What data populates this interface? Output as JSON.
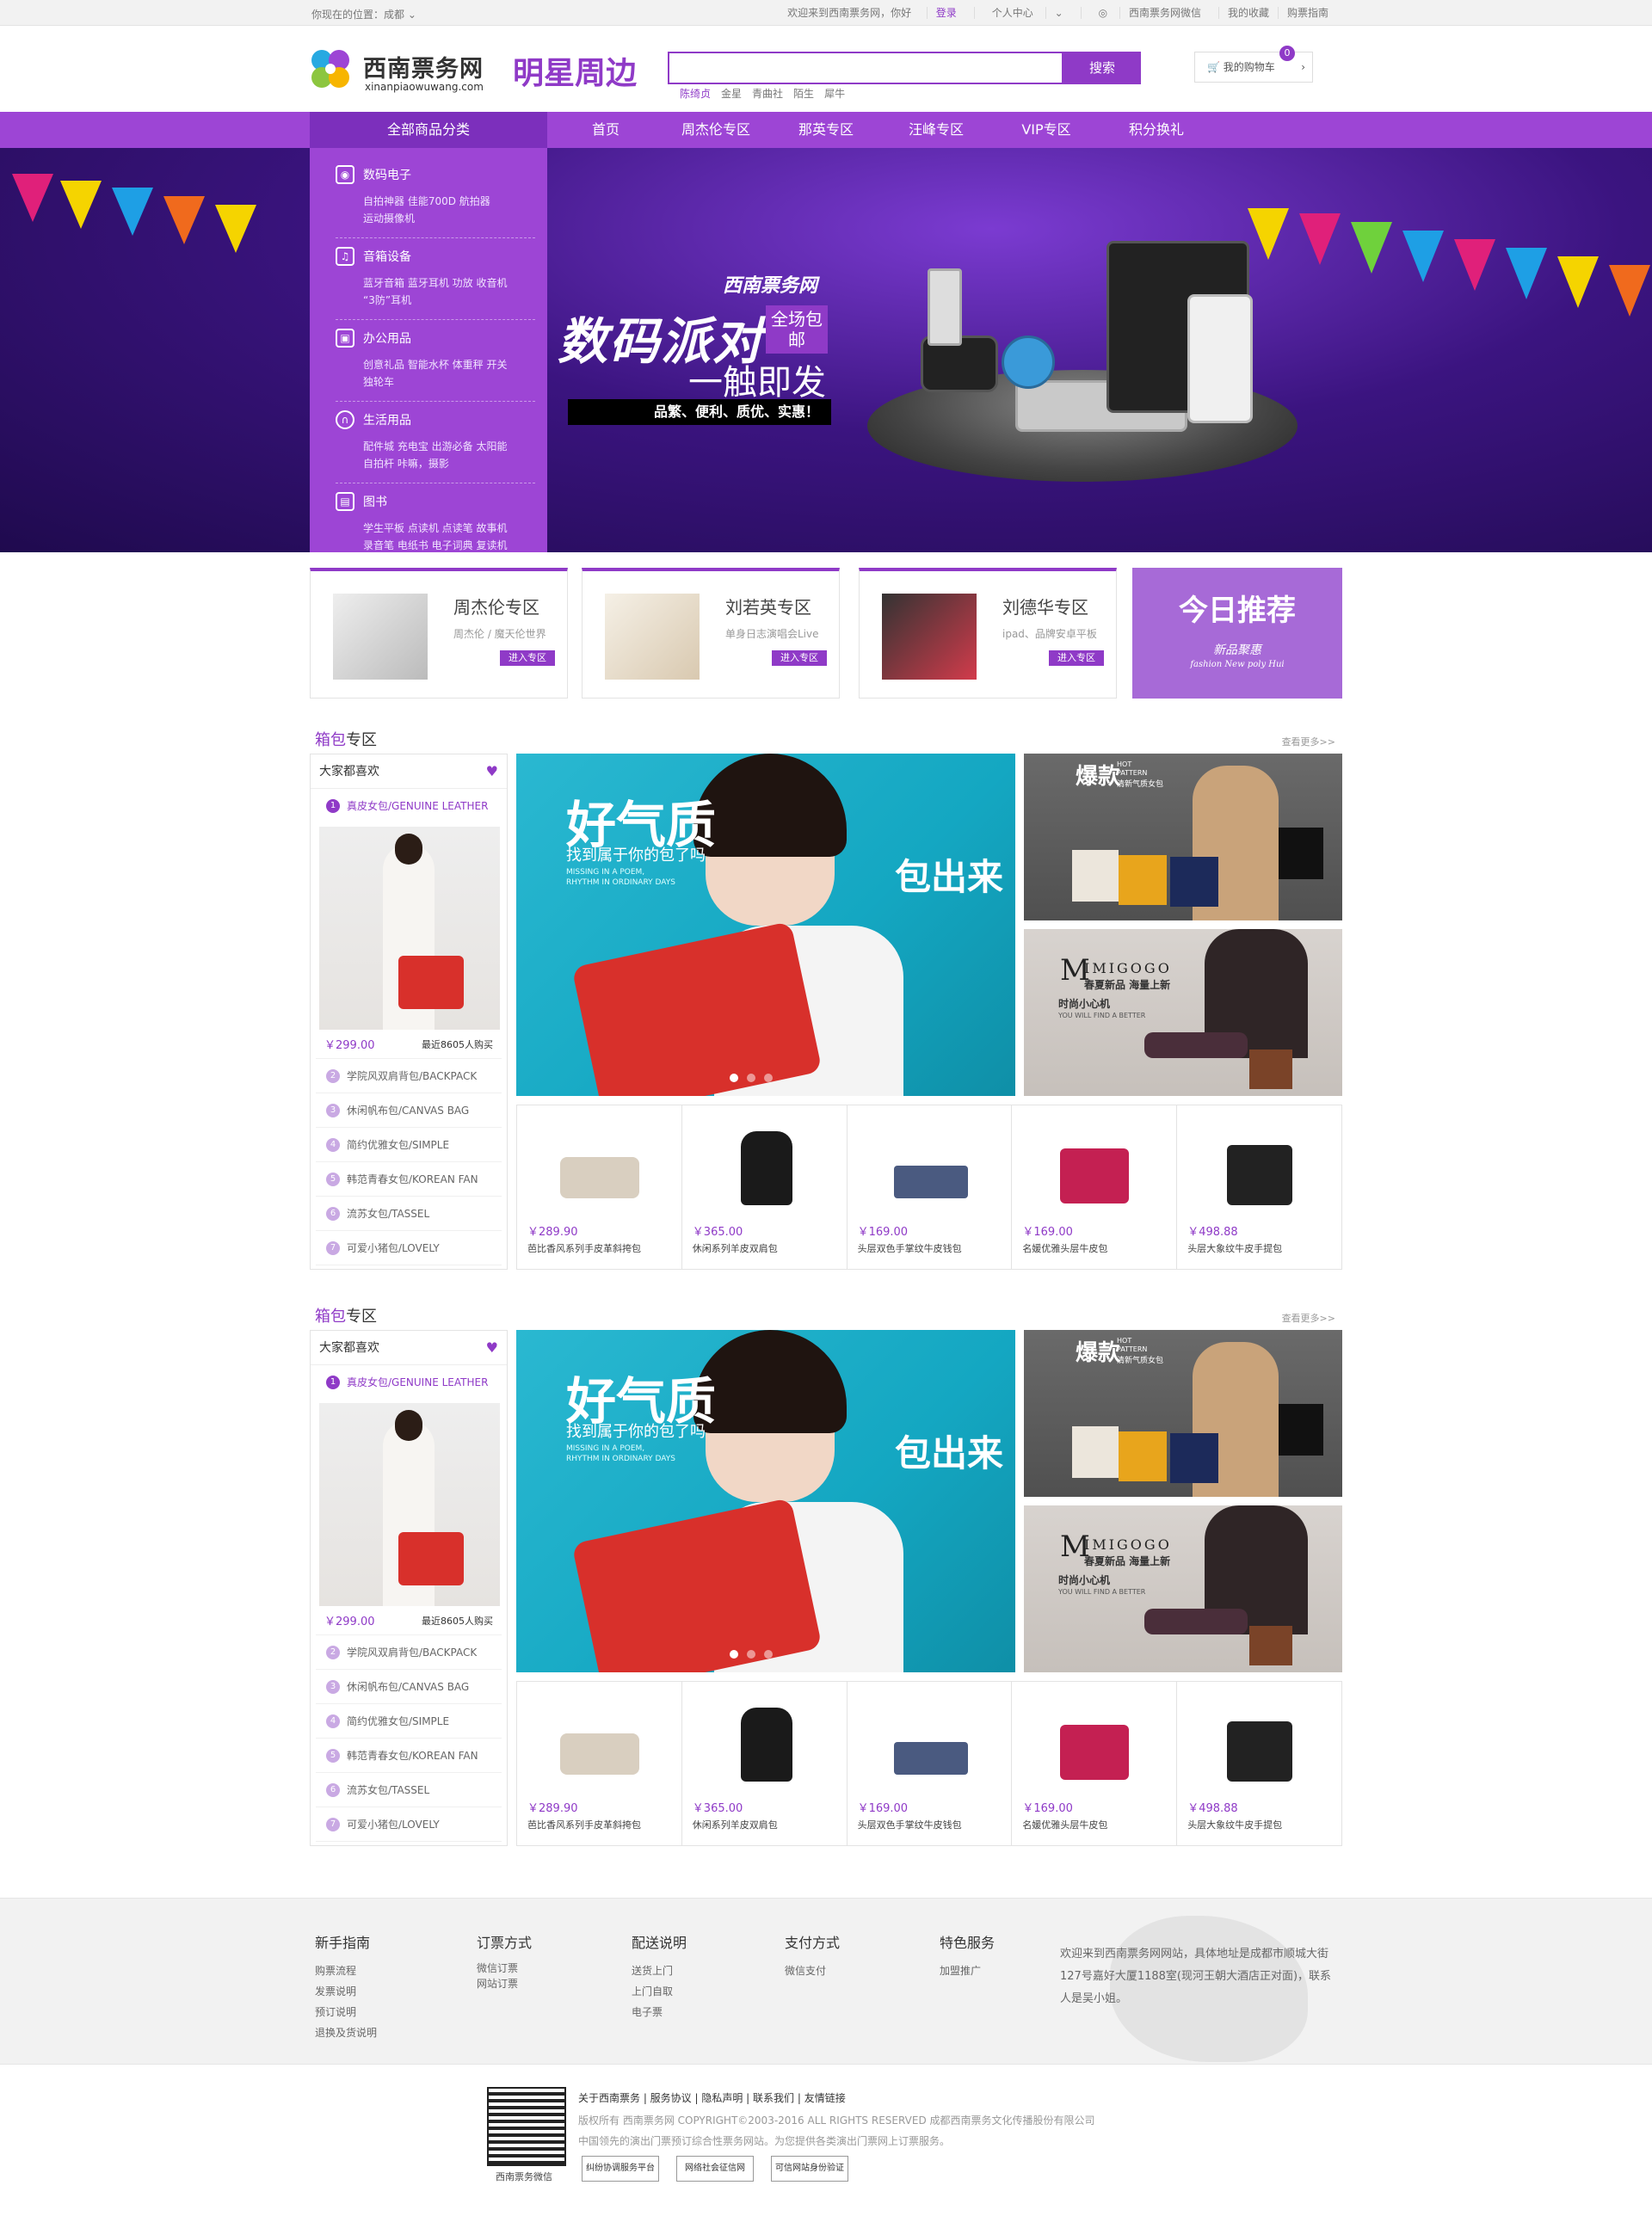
{
  "topbar": {
    "location": "你现在的位置：成都",
    "welcome": "欢迎来到西南票务网，你好",
    "login": "登录",
    "personal": "个人中心",
    "wechat": "西南票务网微信",
    "favorites": "我的收藏",
    "guide": "购票指南"
  },
  "header": {
    "logo_cn": "西南票务网",
    "logo_en": "xinanpiaowuwang.com",
    "subtitle": "明星周边",
    "search_placeholder": "",
    "search_button": "搜索",
    "hot_words": [
      "陈绮贞",
      "金星",
      "青曲社",
      "陌生",
      "犀牛"
    ],
    "cart_label": "我的购物车",
    "cart_count": "0"
  },
  "nav": {
    "all_categories": "全部商品分类",
    "items": [
      "首页",
      "周杰伦专区",
      "那英专区",
      "汪峰专区",
      "VIP专区",
      "积分换礼"
    ]
  },
  "categories": [
    {
      "icon": "camera-icon",
      "title": "数码电子",
      "sub1": "自拍神器  佳能700D  航拍器",
      "sub2": "运动摄像机"
    },
    {
      "icon": "speaker-icon",
      "title": "音箱设备",
      "sub1": "蓝牙音箱  蓝牙耳机  功放  收音机",
      "sub2": "“3防”耳机"
    },
    {
      "icon": "office-icon",
      "title": "办公用品",
      "sub1": "创意礼品  智能水杯  体重秤  开关",
      "sub2": "独轮车"
    },
    {
      "icon": "headphones-icon",
      "title": "生活用品",
      "sub1": "配件城  充电宝  出游必备  太阳能",
      "sub2": "自拍杆  咔嘛，摄影"
    },
    {
      "icon": "book-icon",
      "title": "图书",
      "sub1": "学生平板  点读机  点读笔  故事机",
      "sub2": "录音笔 电纸书 电子词典 复读机"
    }
  ],
  "banner": {
    "brand": "西南票务网",
    "headline": "数码派对",
    "tag": "全场包邮",
    "slogan": "一触即发",
    "bar_text": "品繁、便利、质优、实惠！"
  },
  "zones": [
    {
      "title": "周杰伦专区",
      "desc": "周杰伦 / 魔天伦世界",
      "button": "进入专区"
    },
    {
      "title": "刘若英专区",
      "desc": "单身日志演唱会Live",
      "button": "进入专区"
    },
    {
      "title": "刘德华专区",
      "desc": "ipad、品牌安卓平板",
      "button": "进入专区"
    }
  ],
  "today": {
    "title": "今日推荐",
    "sub": "新品聚惠",
    "sub_en": "fashion New poly Hui"
  },
  "sections": [
    {
      "title_prefix": "箱包",
      "title_suffix": "专区",
      "more": "查看更多>>",
      "rank_header": "大家都喜欢",
      "rank_first": "真皮女包/GENUINE LEATHER",
      "rank_price": "￥299.00",
      "rank_sold": "最近8605人购买",
      "rank_items": [
        "学院风双肩背包/BACKPACK",
        "休闲帆布包/CANVAS BAG",
        "简约优雅女包/SIMPLE",
        "韩范青春女包/KOREAN FAN",
        "流苏女包/TASSEL",
        "可爱小猪包/LOVELY"
      ],
      "banner_h1": "好气质",
      "banner_h2": "找到属于你的包了吗",
      "banner_h3a": "MISSING IN A POEM,",
      "banner_h3b": "RHYTHM IN ORDINARY DAYS",
      "banner_h4": "包出来",
      "side1_t1": "爆款",
      "side1_t2a": "HOT",
      "side1_t2b": "PATTERN",
      "side1_t3": "清新气质女包",
      "side2_t1": "M",
      "side2_t2": "IMIGOGO",
      "side2_t3": "春夏新品 海量上新",
      "side2_t4": "时尚小心机",
      "side2_t5": "YOU WILL FIND A BETTER",
      "products": [
        {
          "price": "￥289.90",
          "name": "芭比香风系列手皮革斜挎包",
          "color": "#d9cfc0"
        },
        {
          "price": "￥365.00",
          "name": "休闲系列羊皮双肩包",
          "color": "#1a1a1a"
        },
        {
          "price": "￥169.00",
          "name": "头层双色手掌纹牛皮钱包",
          "color": "#4a5a80"
        },
        {
          "price": "￥169.00",
          "name": "名媛优雅头层牛皮包",
          "color": "#c42052"
        },
        {
          "price": "￥498.88",
          "name": "头层大象纹牛皮手提包",
          "color": "#222222"
        }
      ]
    },
    {
      "title_prefix": "箱包",
      "title_suffix": "专区",
      "more": "查看更多>>",
      "rank_header": "大家都喜欢",
      "rank_first": "真皮女包/GENUINE LEATHER",
      "rank_price": "￥299.00",
      "rank_sold": "最近8605人购买",
      "rank_items": [
        "学院风双肩背包/BACKPACK",
        "休闲帆布包/CANVAS BAG",
        "简约优雅女包/SIMPLE",
        "韩范青春女包/KOREAN FAN",
        "流苏女包/TASSEL",
        "可爱小猪包/LOVELY"
      ],
      "banner_h1": "好气质",
      "banner_h2": "找到属于你的包了吗",
      "banner_h3a": "MISSING IN A POEM,",
      "banner_h3b": "RHYTHM IN ORDINARY DAYS",
      "banner_h4": "包出来",
      "side1_t1": "爆款",
      "side1_t2a": "HOT",
      "side1_t2b": "PATTERN",
      "side1_t3": "清新气质女包",
      "side2_t1": "M",
      "side2_t2": "IMIGOGO",
      "side2_t3": "春夏新品 海量上新",
      "side2_t4": "时尚小心机",
      "side2_t5": "YOU WILL FIND A BETTER",
      "products": [
        {
          "price": "￥289.90",
          "name": "芭比香风系列手皮革斜挎包",
          "color": "#d9cfc0"
        },
        {
          "price": "￥365.00",
          "name": "休闲系列羊皮双肩包",
          "color": "#1a1a1a"
        },
        {
          "price": "￥169.00",
          "name": "头层双色手掌纹牛皮钱包",
          "color": "#4a5a80"
        },
        {
          "price": "￥169.00",
          "name": "名媛优雅头层牛皮包",
          "color": "#c42052"
        },
        {
          "price": "￥498.88",
          "name": "头层大象纹牛皮手提包",
          "color": "#222222"
        }
      ]
    }
  ],
  "footer": {
    "cols": [
      {
        "title": "新手指南",
        "items": [
          "购票流程",
          "发票说明",
          "预订说明",
          "退换及货说明"
        ]
      },
      {
        "title": "订票方式",
        "items": [
          "微信订票",
          "网站订票"
        ]
      },
      {
        "title": "配送说明",
        "items": [
          "送货上门",
          "上门自取",
          "电子票"
        ]
      },
      {
        "title": "支付方式",
        "items": [
          "微信支付"
        ]
      },
      {
        "title": "特色服务",
        "items": [
          "加盟推广"
        ]
      }
    ],
    "address": "欢迎来到西南票务网网站，具体地址是成都市顺城大街127号嘉好大厦1188室(现河王朝大酒店正对面)，联系人是吴小姐。",
    "links": "关于西南票务 | 服务协议 | 隐私声明 | 联系我们 | 友情链接",
    "copyright": "版权所有 西南票务网 COPYRIGHT©2003-2016 ALL RIGHTS RESERVED 成都西南票务文化传播股份有限公司",
    "notice": "中国领先的演出门票预订综合性票务网站。为您提供各类演出门票网上订票服务。",
    "qr_caption": "西南票务微信",
    "badges": [
      "纠纷协调服务平台",
      "网络社会征信网",
      "可信网站身份验证"
    ]
  },
  "colors": {
    "accent": "#8f3ac7",
    "nav": "#9d45d5"
  }
}
